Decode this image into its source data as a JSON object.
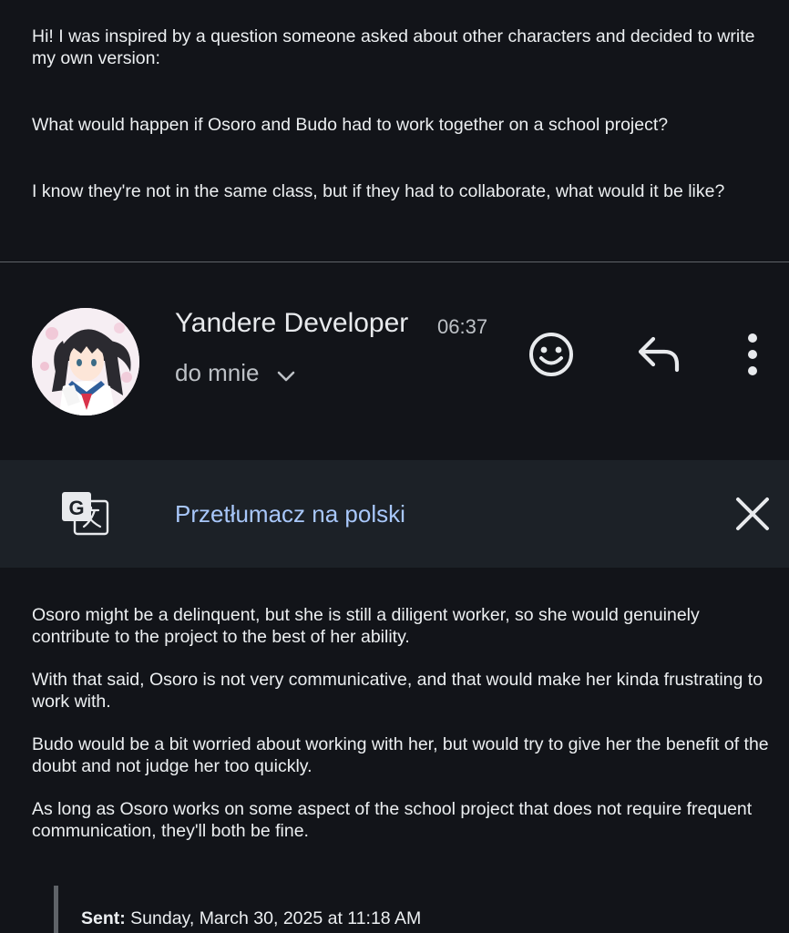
{
  "previous_message": {
    "paragraphs": [
      "Hi! I was inspired by a question someone asked about other characters and decided to write my own version:",
      "What would happen if Osoro and Budo had to work together on a school project?",
      "I know they're not in the same class, but if they had to collaborate, what would it be like?"
    ]
  },
  "header": {
    "sender_name": "Yandere Developer",
    "time": "06:37",
    "recipient": "do mnie",
    "icons": {
      "avatar": "avatar",
      "emoji": "emoji-react-icon",
      "reply": "reply-icon",
      "more": "more-vert-icon",
      "chevron": "chevron-down-icon"
    }
  },
  "translate_bar": {
    "label": "Przetłumacz na polski",
    "icons": {
      "translate": "google-translate-icon",
      "close": "close-icon"
    }
  },
  "message": {
    "paragraphs": [
      "Osoro might be a delinquent, but she is still a diligent worker, so she would genuinely contribute to the project to the best of her ability.",
      "With that said, Osoro is not very communicative, and that would make her kinda frustrating to work with.",
      "Budo would be a bit worried about working with her, but would try to give her the benefit of the doubt and not judge her too quickly.",
      "As long as Osoro works on some aspect of the school project that does not require frequent communication, they'll both be fine."
    ]
  },
  "quoted": {
    "sent_label": "Sent:",
    "sent_value": " Sunday, March 30, 2025 at 11:18 AM"
  },
  "colors": {
    "background": "#121419",
    "translate_bar": "#1c2127",
    "link": "#a8c7fa",
    "text": "#eceff1",
    "muted": "#bdc1c6"
  }
}
